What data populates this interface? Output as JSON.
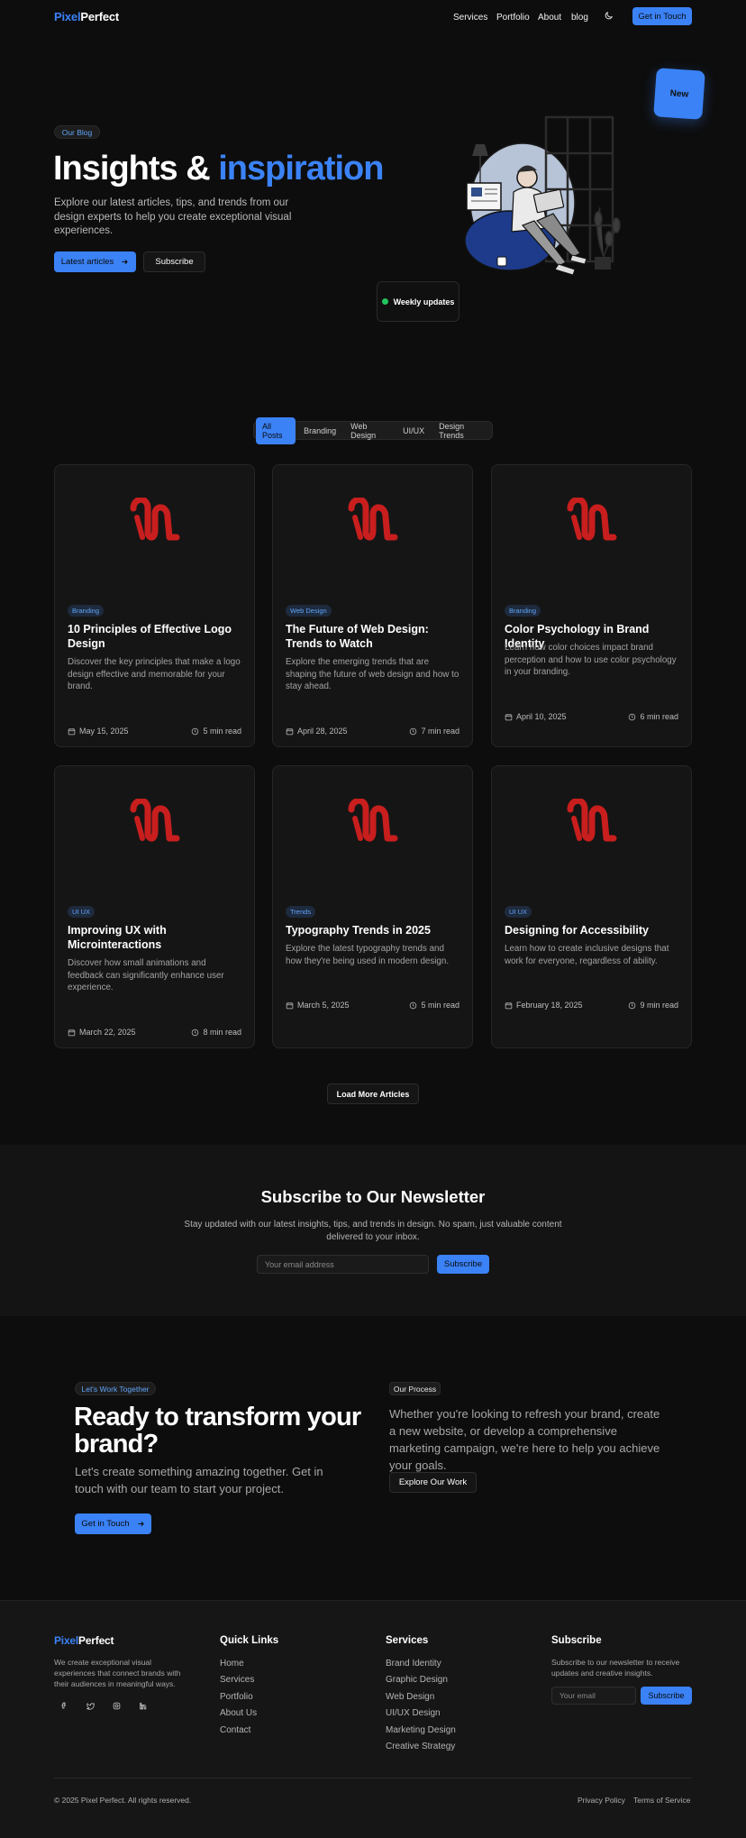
{
  "nav": {
    "logo_a": "Pixel",
    "logo_b": "Perfect",
    "links": [
      "Services",
      "Portfolio",
      "About",
      "blog"
    ],
    "cta": "Get in Touch"
  },
  "hero": {
    "pill": "Our Blog",
    "title_a": "Insights & ",
    "title_b": "inspiration",
    "subtitle": "Explore our latest articles, tips, and trends from our design experts to help you create exceptional visual experiences.",
    "primary_btn": "Latest articles",
    "secondary_btn": "Subscribe",
    "badge_new": "New",
    "weekly": "Weekly updates"
  },
  "filters": [
    "All Posts",
    "Branding",
    "Web Design",
    "UI/UX",
    "Design Trends"
  ],
  "posts": [
    {
      "tag": "Branding",
      "title": "10 Principles of Effective Logo Design",
      "desc": "Discover the key principles that make a logo design effective and memorable for your brand.",
      "date": "May 15, 2025",
      "read": "5 min read"
    },
    {
      "tag": "Web Design",
      "title": "The Future of Web Design: Trends to Watch",
      "desc": "Explore the emerging trends that are shaping the future of web design and how to stay ahead.",
      "date": "April 28, 2025",
      "read": "7 min read"
    },
    {
      "tag": "Branding",
      "title": "Color Psychology in Brand Identity",
      "desc": "Learn how color choices impact brand perception and how to use color psychology in your branding.",
      "date": "April 10, 2025",
      "read": "6 min read"
    },
    {
      "tag": "UI UX",
      "title": "Improving UX with Microinteractions",
      "desc": "Discover how small animations and feedback can significantly enhance user experience.",
      "date": "March 22, 2025",
      "read": "8 min read"
    },
    {
      "tag": "Trends",
      "title": "Typography Trends in 2025",
      "desc": "Explore the latest typography trends and how they're being used in modern design.",
      "date": "March 5, 2025",
      "read": "5 min read"
    },
    {
      "tag": "UI UX",
      "title": "Designing for Accessibility",
      "desc": "Learn how to create inclusive designs that work for everyone, regardless of ability.",
      "date": "February 18, 2025",
      "read": "9 min read"
    }
  ],
  "load_more": "Load More Articles",
  "newsletter": {
    "title": "Subscribe to Our Newsletter",
    "text": "Stay updated with our latest insights, tips, and trends in design. No spam, just valuable content delivered to your inbox.",
    "placeholder": "Your email address",
    "button": "Subscribe"
  },
  "cta": {
    "pill_left": "Let's Work Together",
    "title": "Ready to transform your brand?",
    "text": "Let's create something amazing together. Get in touch with our team to start your project.",
    "button": "Get in Touch",
    "pill_right": "Our Process",
    "right_text": "Whether you're looking to refresh your brand, create a new website, or develop a comprehensive marketing campaign, we're here to help you achieve your goals.",
    "right_button": "Explore Our Work"
  },
  "footer": {
    "about": "We create exceptional visual experiences that connect brands with their audiences in meaningful ways.",
    "quick_title": "Quick Links",
    "quick_links": [
      "Home",
      "Services",
      "Portfolio",
      "About Us",
      "Contact"
    ],
    "services_title": "Services",
    "services": [
      "Brand Identity",
      "Graphic Design",
      "Web Design",
      "UI/UX Design",
      "Marketing Design",
      "Creative Strategy"
    ],
    "subscribe_title": "Subscribe",
    "subscribe_text": "Subscribe to our newsletter to receive updates and creative insights.",
    "email_placeholder": "Your email",
    "subscribe_btn": "Subscribe",
    "copyright": "© 2025 Pixel Perfect. All rights reserved.",
    "privacy": "Privacy Policy",
    "terms": "Terms of Service"
  },
  "colors": {
    "accent": "#3b82f6",
    "background": "#0d0d0d",
    "logo_red": "#c81e1e",
    "online": "#22c55e"
  }
}
